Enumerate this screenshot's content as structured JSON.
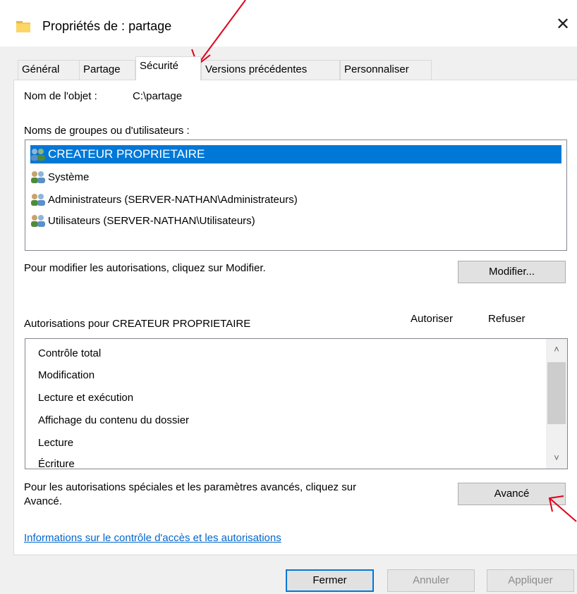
{
  "window": {
    "title": "Propriétés de : partage",
    "close_glyph": "✕"
  },
  "tabs": [
    {
      "label": "Général"
    },
    {
      "label": "Partage"
    },
    {
      "label": "Sécurité"
    },
    {
      "label": "Versions précédentes"
    },
    {
      "label": "Personnaliser"
    }
  ],
  "active_tab": "Sécurité",
  "object": {
    "label": "Nom de l'objet :",
    "value": "C:\\partage"
  },
  "groups": {
    "label": "Noms de groupes ou d'utilisateurs :",
    "items": [
      {
        "label": "CREATEUR PROPRIETAIRE",
        "icon": "users-icon",
        "selected": true
      },
      {
        "label": "Système",
        "icon": "users-icon"
      },
      {
        "label": "Administrateurs (SERVER-NATHAN\\Administrateurs)",
        "icon": "users-icon"
      },
      {
        "label": "Utilisateurs (SERVER-NATHAN\\Utilisateurs)",
        "icon": "users-icon"
      }
    ]
  },
  "modify": {
    "hint": "Pour modifier les autorisations, cliquez sur Modifier.",
    "button": "Modifier..."
  },
  "permissions": {
    "title": "Autorisations pour CREATEUR PROPRIETAIRE",
    "col_allow": "Autoriser",
    "col_deny": "Refuser",
    "items": [
      {
        "label": "Contrôle total"
      },
      {
        "label": "Modification"
      },
      {
        "label": "Lecture et exécution"
      },
      {
        "label": "Affichage du contenu du dossier"
      },
      {
        "label": "Lecture"
      },
      {
        "label": "Écriture"
      }
    ]
  },
  "advanced": {
    "hint_line1": "Pour les autorisations spéciales et les paramètres avancés, cliquez sur",
    "hint_line2": "Avancé.",
    "button": "Avancé"
  },
  "link": "Informations sur le contrôle d'accès et les autorisations",
  "footer": {
    "close": "Fermer",
    "cancel": "Annuler",
    "apply": "Appliquer"
  },
  "colors": {
    "selection": "#0078d7",
    "link": "#0066cc",
    "annotation": "#e0001b"
  }
}
